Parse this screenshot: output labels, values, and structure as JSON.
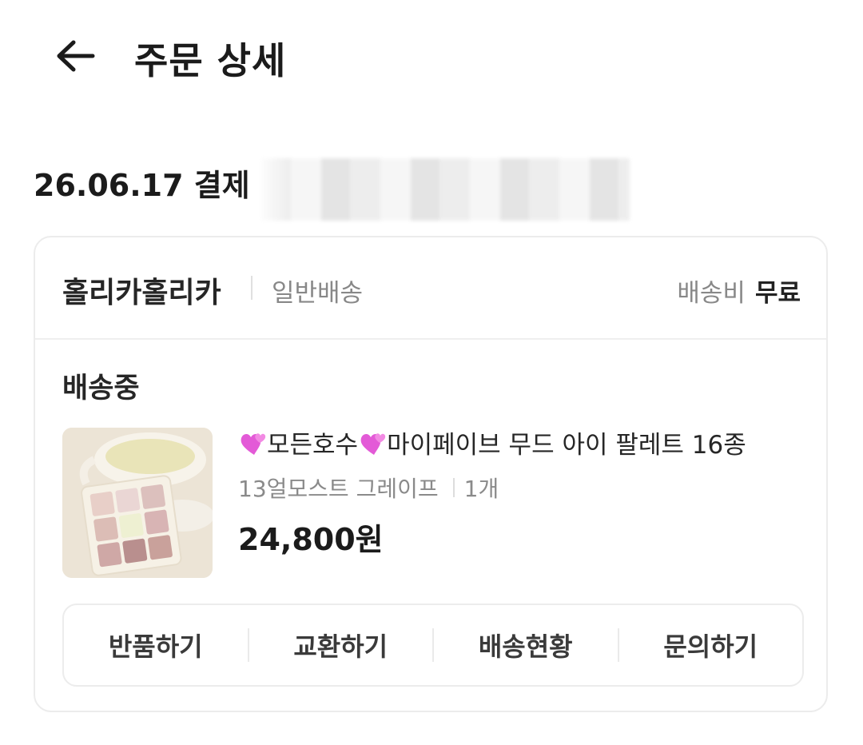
{
  "header": {
    "title": "주문 상세",
    "back_icon": "arrow-left-icon"
  },
  "order": {
    "date_label": "26.06.17 결제"
  },
  "seller": {
    "name": "홀리카홀리카",
    "shipping_type": "일반배송",
    "shipping_fee_label": "배송비",
    "shipping_fee_value": "무료"
  },
  "item": {
    "status": "배송중",
    "name_part1": "모든호수",
    "name_part2": "마이페이브 무드 아이 팔레트 16종",
    "option": "13얼모스트 그레이프",
    "quantity": "1개",
    "price": "24,800원"
  },
  "actions": {
    "return": "반품하기",
    "exchange": "교환하기",
    "tracking": "배송현황",
    "inquiry": "문의하기"
  },
  "colors": {
    "heart": "#e35ad7",
    "border": "#ececec"
  }
}
